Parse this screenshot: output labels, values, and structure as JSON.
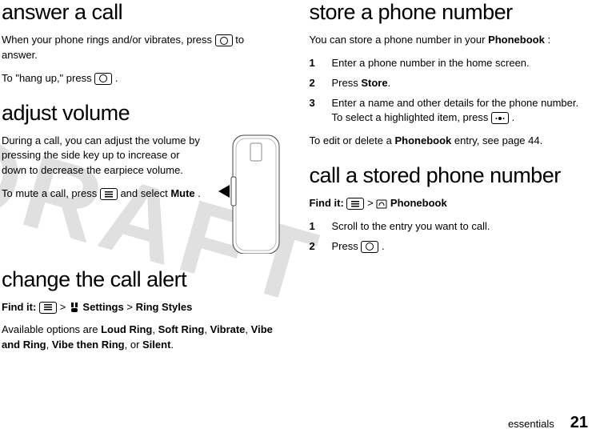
{
  "watermark": "DRAFT",
  "left": {
    "answer": {
      "heading": "answer a call",
      "p1_a": "When your phone rings and/or vibrates, press ",
      "p1_b": " to answer.",
      "p2_a": "To \"hang up,\" press ",
      "p2_b": "."
    },
    "adjust": {
      "heading": "adjust volume",
      "p1": "During a call, you can adjust the volume by pressing the side key up to increase or down to decrease the earpiece volume.",
      "p2_a": "To mute a call, press ",
      "p2_b": " and select ",
      "mute": "Mute",
      "p2_c": "."
    },
    "change": {
      "heading": "change the call alert",
      "findit_label": "Find it:",
      "path_settings": "Settings",
      "path_ring": "Ring Styles",
      "gt": " > ",
      "p1_a": "Available options are ",
      "loud": "Loud Ring",
      "soft": "Soft Ring",
      "vibrate": "Vibrate",
      "vibeand": "Vibe and Ring",
      "vibethen": "Vibe then Ring",
      "silent": "Silent",
      "comma": ", ",
      "or": ", or ",
      "period": "."
    }
  },
  "right": {
    "store": {
      "heading": "store a phone number",
      "p1_a": "You can store a phone number in your ",
      "pb": "Phonebook",
      "p1_b": ":",
      "s1": "Enter a phone number in the home screen.",
      "s2_a": "Press ",
      "s2_store": "Store",
      "s2_b": ".",
      "s3_a": "Enter a name and other details for the phone number. To select a highlighted item, press ",
      "s3_b": ".",
      "p2_a": "To edit or delete a ",
      "p2_b": " entry, see page 44."
    },
    "callstored": {
      "heading": "call a stored phone number",
      "findit_label": "Find it:",
      "gt": " > ",
      "pb": "Phonebook",
      "s1": "Scroll to the entry you want to call.",
      "s2_a": "Press ",
      "s2_b": "."
    }
  },
  "step_nums": {
    "n1": "1",
    "n2": "2",
    "n3": "3"
  },
  "footer": {
    "section": "essentials",
    "page": "21"
  }
}
